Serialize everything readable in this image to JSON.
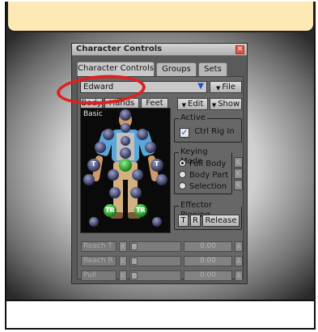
{
  "window": {
    "title": "Character Controls",
    "close_glyph": "✕",
    "tabs": [
      {
        "label": "Character Controls",
        "active": true
      },
      {
        "label": "Groups",
        "active": false
      },
      {
        "label": "Sets",
        "active": false
      }
    ]
  },
  "character_dropdown": {
    "value": "Edward",
    "arrow": "▼"
  },
  "buttons": {
    "file": "File",
    "edit": "Edit",
    "show": "Show",
    "arrow_glyph": "▼"
  },
  "view_tabs": [
    "Body",
    "Hands",
    "Feet"
  ],
  "rig_view": {
    "label": "Basic",
    "tags": [
      "T",
      "T",
      "TR",
      "TR"
    ]
  },
  "active_group": {
    "label": "Active",
    "checkbox_label": "Ctrl Rig In",
    "checked": true,
    "check_glyph": "✓"
  },
  "keying_mode": {
    "label": "Keying Mode",
    "options": [
      {
        "label": "Full Body",
        "selected": true
      },
      {
        "label": "Body Part",
        "selected": false
      },
      {
        "label": "Selection",
        "selected": false
      }
    ],
    "key_glyph": "K"
  },
  "effector_pinning": {
    "label": "Effector Pinning",
    "buttons": [
      "T",
      "R",
      "Release"
    ]
  },
  "sliders": [
    {
      "label": "Reach T",
      "k": "K",
      "value": "0.00",
      "a": "A"
    },
    {
      "label": "Reach R",
      "k": "K",
      "value": "0.00",
      "a": "A"
    },
    {
      "label": "Pull",
      "k": "K",
      "value": "0.00",
      "a": "A"
    }
  ],
  "colors": {
    "highlight_ring": "#e02020",
    "callout_fill": "#fde9b6",
    "selected_effector": "#2fa52f",
    "idle_effector": "#4a4e7a"
  }
}
